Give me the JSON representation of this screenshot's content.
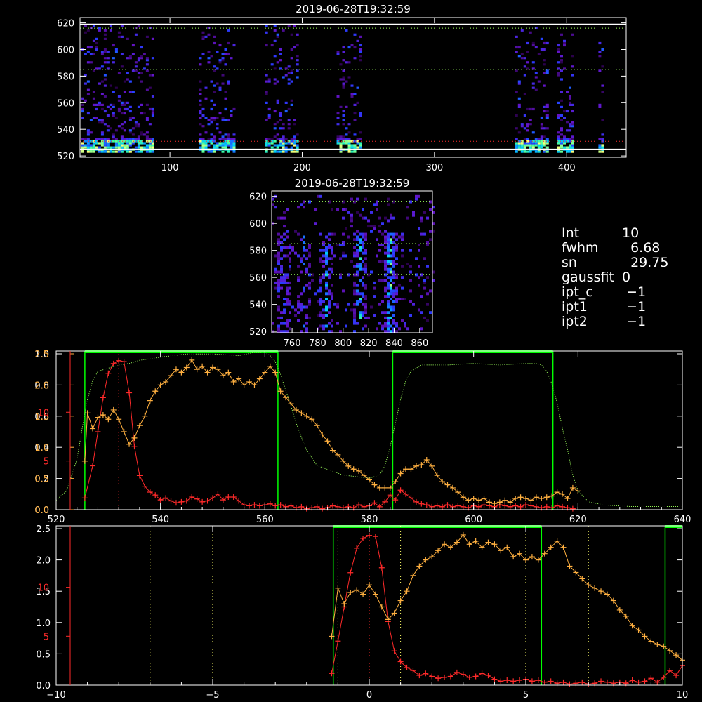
{
  "colors": {
    "background": "#000000",
    "axis": "#ffffff",
    "red_series": "#ff2a2a",
    "orange_series": "#ffb040",
    "green_band": "#00ff00",
    "green_dotted": "#9cff5a",
    "yellow_dotted": "#ffff66",
    "red_axis": "#ff2a2a"
  },
  "info": {
    "rows": [
      {
        "k": "Int",
        "v": "10"
      },
      {
        "k": "fwhm",
        "v": "  6.68"
      },
      {
        "k": "sn",
        "v": "  29.75"
      },
      {
        "k": "gaussfit",
        "v": "0"
      },
      {
        "k": "ipt_c",
        "v": " −1"
      },
      {
        "k": "ipt1",
        "v": " −1"
      },
      {
        "k": "ipt2",
        "v": " −1"
      }
    ]
  },
  "chart_data": [
    {
      "type": "heatmap",
      "title": "2019-06-28T19:32:59",
      "xlim": [
        32,
        445
      ],
      "ylim": [
        519,
        624
      ],
      "xticks": [
        100,
        200,
        300,
        400
      ],
      "yticks": [
        520,
        540,
        560,
        580,
        600,
        620
      ],
      "hlines": [
        {
          "y": 619,
          "color": "#ffffff",
          "style": "solid"
        },
        {
          "y": 616,
          "color": "#9cff5a",
          "style": "dotted"
        },
        {
          "y": 585,
          "color": "#9cff5a",
          "style": "dotted"
        },
        {
          "y": 562,
          "color": "#9cff5a",
          "style": "dotted"
        },
        {
          "y": 531,
          "color": "#ff2a2a",
          "style": "dotted"
        },
        {
          "y": 525,
          "color": "#ffffff",
          "style": "solid"
        }
      ],
      "columns": [
        [
          33,
          88
        ],
        [
          122,
          148
        ],
        [
          172,
          196
        ],
        [
          226,
          244
        ],
        [
          361,
          385
        ],
        [
          393,
          404
        ],
        [
          424,
          427
        ]
      ]
    },
    {
      "type": "heatmap",
      "title": "2019-06-28T19:32:59",
      "xlim": [
        744,
        870
      ],
      "ylim": [
        519,
        624
      ],
      "xticks": [
        760,
        780,
        800,
        820,
        840,
        860
      ],
      "yticks": [
        520,
        540,
        560,
        580,
        600,
        620
      ],
      "hlines": [
        {
          "y": 616,
          "color": "#9cff5a",
          "style": "dotted"
        },
        {
          "y": 585,
          "color": "#9cff5a",
          "style": "dotted"
        },
        {
          "y": 562,
          "color": "#9cff5a",
          "style": "dotted"
        }
      ],
      "streaks": [
        [
          752,
          0.6
        ],
        [
          768,
          0.55
        ],
        [
          786,
          0.7
        ],
        [
          812,
          0.85
        ],
        [
          836,
          1.0
        ]
      ]
    },
    {
      "type": "line",
      "xlim": [
        520,
        640
      ],
      "xticks": [
        520,
        540,
        560,
        580,
        600,
        620,
        640
      ],
      "left_ticks_white": [
        {
          "v": 0.0,
          "label": "0.0"
        },
        {
          "v": 0.2,
          "label": "0.2"
        },
        {
          "v": 0.4,
          "label": "0.4"
        },
        {
          "v": 0.6,
          "label": "0.6"
        },
        {
          "v": 0.8,
          "label": "0.8"
        },
        {
          "v": 1.0,
          "label": "1.0"
        }
      ],
      "left_ticks_orange": [
        {
          "v": 0.0,
          "label": "0.0"
        },
        {
          "v": 0.5,
          "label": "0.5"
        },
        {
          "v": 1.0,
          "label": "1.0"
        },
        {
          "v": 1.5,
          "label": "1.5"
        },
        {
          "v": 2.0,
          "label": "2.0"
        },
        {
          "v": 2.5,
          "label": "2.5"
        }
      ],
      "left_ticks_red": [
        {
          "v": 5,
          "label": "5"
        },
        {
          "v": 10,
          "label": "10"
        }
      ],
      "green_bands": [
        [
          525.5,
          562.5
        ],
        [
          584.5,
          615.2
        ]
      ],
      "red_vline": 532,
      "transmission": {
        "x": [
          520,
          522,
          524,
          525,
          526,
          527,
          528,
          530,
          532,
          534,
          536,
          538,
          540,
          545,
          550,
          555,
          558,
          560,
          561,
          562,
          563,
          564,
          565,
          566,
          567,
          568,
          570,
          575,
          580,
          582,
          583,
          584,
          585,
          586,
          587,
          588,
          590,
          595,
          600,
          605,
          610,
          612,
          613,
          614,
          615,
          616,
          617,
          618,
          619,
          620,
          622,
          625,
          630,
          635,
          640
        ],
        "y": [
          0.06,
          0.12,
          0.32,
          0.52,
          0.7,
          0.82,
          0.88,
          0.9,
          0.92,
          0.93,
          0.95,
          0.96,
          0.97,
          0.99,
          0.99,
          0.98,
          1.0,
          1.0,
          0.98,
          0.94,
          0.86,
          0.76,
          0.66,
          0.55,
          0.46,
          0.38,
          0.28,
          0.22,
          0.2,
          0.22,
          0.28,
          0.4,
          0.55,
          0.7,
          0.82,
          0.88,
          0.92,
          0.92,
          0.93,
          0.92,
          0.93,
          0.93,
          0.92,
          0.88,
          0.8,
          0.68,
          0.52,
          0.38,
          0.22,
          0.12,
          0.05,
          0.03,
          0.02,
          0.02,
          0.02
        ]
      },
      "series": [
        {
          "color": "#ff2a2a",
          "scale_max": 16,
          "x": [
            525.5,
            527,
            528,
            529,
            530,
            531,
            532,
            533,
            534,
            535,
            536,
            537,
            538,
            539,
            540,
            541,
            542,
            543,
            544,
            545,
            546,
            547,
            548,
            549,
            550,
            551,
            552,
            553,
            554,
            555,
            556,
            557,
            558,
            559,
            560,
            561,
            562,
            563,
            564,
            565,
            566,
            567,
            568,
            569,
            570,
            571,
            572,
            573,
            574,
            575,
            576,
            577,
            578,
            579,
            580,
            581,
            582,
            583,
            584,
            585,
            586,
            587,
            588,
            589,
            590,
            591,
            592,
            593,
            594,
            595,
            596,
            597,
            598,
            599,
            600,
            601,
            602,
            603,
            604,
            605,
            606,
            607,
            608,
            609,
            610,
            611,
            612,
            613,
            614,
            615,
            616,
            617,
            618,
            619
          ],
          "y": [
            1.2,
            4.5,
            8.0,
            11.5,
            14.0,
            15.0,
            15.3,
            15.2,
            12.0,
            6.5,
            3.5,
            2.4,
            1.8,
            1.5,
            1.0,
            1.2,
            0.9,
            0.7,
            0.8,
            0.9,
            1.3,
            1.1,
            0.8,
            0.9,
            1.2,
            1.6,
            1.0,
            1.3,
            1.3,
            0.9,
            0.5,
            0.4,
            0.5,
            0.4,
            0.5,
            0.6,
            0.4,
            0.5,
            0.3,
            0.4,
            0.2,
            0.3,
            0.1,
            0.2,
            0.3,
            0.1,
            0.2,
            0.4,
            0.3,
            0.2,
            0.3,
            0.2,
            0.5,
            0.3,
            0.4,
            0.7,
            0.3,
            0.8,
            1.5,
            1.0,
            2.0,
            1.6,
            1.2,
            0.8,
            0.6,
            0.5,
            0.3,
            0.4,
            0.3,
            0.5,
            0.3,
            0.4,
            0.3,
            0.2,
            0.4,
            0.3,
            0.5,
            0.4,
            0.3,
            0.5,
            0.4,
            0.3,
            0.4,
            0.3,
            0.5,
            0.4,
            0.3,
            0.2,
            0.3,
            0.2,
            0.4,
            0.3,
            0.2,
            0.1
          ]
        },
        {
          "color": "#ffb040",
          "scale_max": 2.5,
          "x": [
            525.5,
            526,
            527,
            528,
            529,
            530,
            531,
            532,
            533,
            534,
            535,
            536,
            537,
            538,
            539,
            540,
            541,
            542,
            543,
            544,
            545,
            546,
            547,
            548,
            549,
            550,
            551,
            552,
            553,
            554,
            555,
            556,
            557,
            558,
            559,
            560,
            561,
            562,
            563,
            564,
            565,
            566,
            567,
            568,
            569,
            570,
            571,
            572,
            573,
            574,
            575,
            576,
            577,
            578,
            579,
            580,
            581,
            582,
            583,
            584,
            585,
            586,
            587,
            588,
            589,
            590,
            591,
            592,
            593,
            594,
            595,
            596,
            597,
            598,
            599,
            600,
            601,
            602,
            603,
            604,
            605,
            606,
            607,
            608,
            609,
            610,
            611,
            612,
            613,
            614,
            615,
            616,
            617,
            618,
            619,
            620
          ],
          "y": [
            0.78,
            1.55,
            1.3,
            1.48,
            1.52,
            1.45,
            1.6,
            1.45,
            1.25,
            1.05,
            1.15,
            1.35,
            1.5,
            1.75,
            1.9,
            2.0,
            2.05,
            2.15,
            2.25,
            2.2,
            2.28,
            2.4,
            2.25,
            2.3,
            2.2,
            2.28,
            2.25,
            2.15,
            2.2,
            2.05,
            2.1,
            2.0,
            2.05,
            2.0,
            2.1,
            2.2,
            2.3,
            2.2,
            1.9,
            1.8,
            1.7,
            1.6,
            1.55,
            1.5,
            1.45,
            1.35,
            1.2,
            1.1,
            0.95,
            0.88,
            0.78,
            0.7,
            0.65,
            0.62,
            0.55,
            0.48,
            0.4,
            0.35,
            0.35,
            0.35,
            0.45,
            0.58,
            0.65,
            0.65,
            0.7,
            0.72,
            0.8,
            0.7,
            0.55,
            0.45,
            0.4,
            0.35,
            0.28,
            0.2,
            0.15,
            0.18,
            0.15,
            0.18,
            0.12,
            0.1,
            0.12,
            0.15,
            0.12,
            0.18,
            0.2,
            0.18,
            0.15,
            0.2,
            0.18,
            0.2,
            0.22,
            0.28,
            0.25,
            0.18,
            0.35,
            0.3
          ]
        }
      ]
    },
    {
      "type": "line",
      "xlim": [
        -10,
        10
      ],
      "xticks": [
        -10,
        -5,
        0,
        5,
        10
      ],
      "left_ticks_white": [
        {
          "v": 0.0,
          "label": "0.0"
        },
        {
          "v": 0.5,
          "label": "0.5"
        },
        {
          "v": 1.0,
          "label": "1.0"
        },
        {
          "v": 1.5,
          "label": "1.5"
        },
        {
          "v": 2.0,
          "label": "2.0"
        },
        {
          "v": 2.5,
          "label": "2.5"
        }
      ],
      "left_ticks_red": [
        {
          "v": 5,
          "label": "5"
        },
        {
          "v": 10,
          "label": "10"
        }
      ],
      "green_bands": [
        [
          -1.15,
          5.5
        ],
        [
          9.45,
          10.3
        ]
      ],
      "yellow_vlines": [
        -7,
        -5,
        -1,
        1,
        5,
        7
      ],
      "red_vline": 0,
      "series": [
        {
          "color": "#ff2a2a",
          "scale_max": 16,
          "x": [
            -1.2,
            -1.0,
            -0.8,
            -0.6,
            -0.4,
            -0.2,
            0.0,
            0.2,
            0.4,
            0.6,
            0.8,
            1.0,
            1.2,
            1.4,
            1.6,
            1.8,
            2.0,
            2.2,
            2.4,
            2.6,
            2.8,
            3.0,
            3.2,
            3.4,
            3.6,
            3.8,
            4.0,
            4.2,
            4.4,
            4.6,
            4.8,
            5.0,
            5.2,
            5.4,
            5.6,
            5.8,
            6.0,
            6.2,
            6.4,
            6.6,
            6.8,
            7.0,
            7.2,
            7.4,
            7.6,
            7.8,
            8.0,
            8.2,
            8.4,
            8.6,
            8.8,
            9.0,
            9.2,
            9.4,
            9.6,
            9.8,
            10.0
          ],
          "y": [
            1.2,
            4.5,
            8.0,
            11.5,
            14.0,
            15.0,
            15.3,
            15.2,
            12.0,
            6.5,
            3.5,
            2.4,
            1.8,
            1.5,
            1.0,
            1.2,
            0.9,
            0.7,
            0.8,
            0.9,
            1.3,
            1.1,
            0.8,
            0.9,
            1.2,
            1.0,
            0.6,
            0.4,
            0.5,
            0.4,
            0.5,
            0.6,
            0.4,
            0.5,
            0.3,
            0.4,
            0.2,
            0.3,
            0.1,
            0.2,
            0.3,
            0.1,
            0.2,
            0.4,
            0.3,
            0.2,
            0.3,
            0.2,
            0.5,
            0.3,
            0.4,
            0.7,
            0.3,
            0.8,
            1.5,
            1.0,
            2.0
          ]
        },
        {
          "color": "#ffb040",
          "scale_max": 2.5,
          "x": [
            -1.2,
            -1.0,
            -0.8,
            -0.6,
            -0.4,
            -0.2,
            0.0,
            0.2,
            0.4,
            0.6,
            0.8,
            1.0,
            1.2,
            1.4,
            1.6,
            1.8,
            2.0,
            2.2,
            2.4,
            2.6,
            2.8,
            3.0,
            3.2,
            3.4,
            3.6,
            3.8,
            4.0,
            4.2,
            4.4,
            4.6,
            4.8,
            5.0,
            5.2,
            5.4,
            5.6,
            5.8,
            6.0,
            6.2,
            6.4,
            6.6,
            6.8,
            7.0,
            7.2,
            7.4,
            7.6,
            7.8,
            8.0,
            8.2,
            8.4,
            8.6,
            8.8,
            9.0,
            9.2,
            9.4,
            9.6,
            9.8,
            10.0
          ],
          "y": [
            0.78,
            1.55,
            1.3,
            1.48,
            1.52,
            1.45,
            1.6,
            1.45,
            1.25,
            1.05,
            1.15,
            1.35,
            1.5,
            1.75,
            1.9,
            2.0,
            2.05,
            2.15,
            2.25,
            2.2,
            2.28,
            2.4,
            2.25,
            2.3,
            2.2,
            2.28,
            2.25,
            2.15,
            2.2,
            2.05,
            2.1,
            2.0,
            2.05,
            2.0,
            2.1,
            2.2,
            2.3,
            2.2,
            1.9,
            1.8,
            1.7,
            1.6,
            1.55,
            1.5,
            1.45,
            1.35,
            1.2,
            1.1,
            0.95,
            0.88,
            0.78,
            0.7,
            0.65,
            0.62,
            0.55,
            0.48,
            0.4
          ]
        }
      ]
    }
  ]
}
